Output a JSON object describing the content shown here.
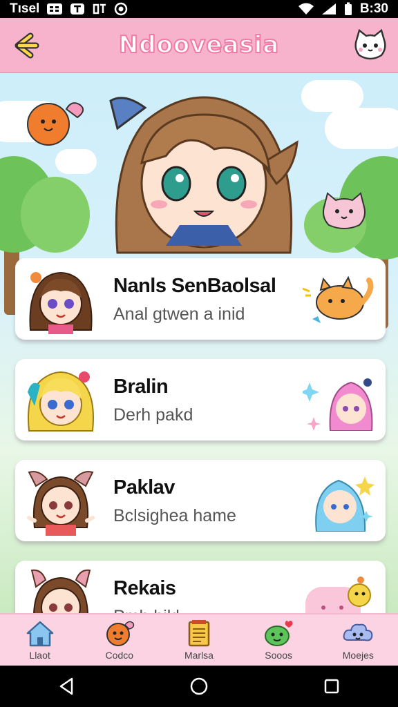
{
  "status_bar": {
    "left_text": "Tısel",
    "left_icons": [
      "grid-icon",
      "notification-icon",
      "settings-icon",
      "record-icon"
    ],
    "right_icons": [
      "wifi-icon",
      "signal-icon",
      "battery-icon"
    ],
    "time": "B:30"
  },
  "header": {
    "title": "Ndooveasia",
    "back_icon": "back-arrow-icon",
    "profile_icon": "cat-face-icon"
  },
  "hero": {
    "character": "anime-girl-with-cat-ears",
    "decorations": [
      "orange-heart-creature",
      "pink-cat-creature",
      "trees",
      "clouds"
    ]
  },
  "list": [
    {
      "name": "Nanls SenBaolsal",
      "subtitle": "Anal gtwen a inid",
      "avatar": "brown-haired-girl-avatar",
      "deco": "orange-cat-icon"
    },
    {
      "name": "Bralin",
      "subtitle": "Derh pakd",
      "avatar": "blonde-girl-avatar",
      "deco": "pink-haired-girl-icon"
    },
    {
      "name": "Paklav",
      "subtitle": "Bclsighea hame",
      "avatar": "brown-eared-girl-avatar",
      "deco": "blue-haired-girl-icon"
    },
    {
      "name": "Rekais",
      "subtitle": "Pmh bikl",
      "avatar": "bunny-eared-girl-avatar",
      "deco": "pink-pet-icon"
    }
  ],
  "tabs": [
    {
      "label": "Llaot",
      "icon": "home-icon"
    },
    {
      "label": "Codco",
      "icon": "orange-blob-icon"
    },
    {
      "label": "Marlsa",
      "icon": "notepad-icon"
    },
    {
      "label": "Sooos",
      "icon": "green-blob-icon"
    },
    {
      "label": "Moejes",
      "icon": "cloud-face-icon"
    }
  ],
  "colors": {
    "header_pink": "#f7b3cc",
    "tabbar_pink": "#fbd3e2",
    "title_outline": "#f17aa6"
  }
}
